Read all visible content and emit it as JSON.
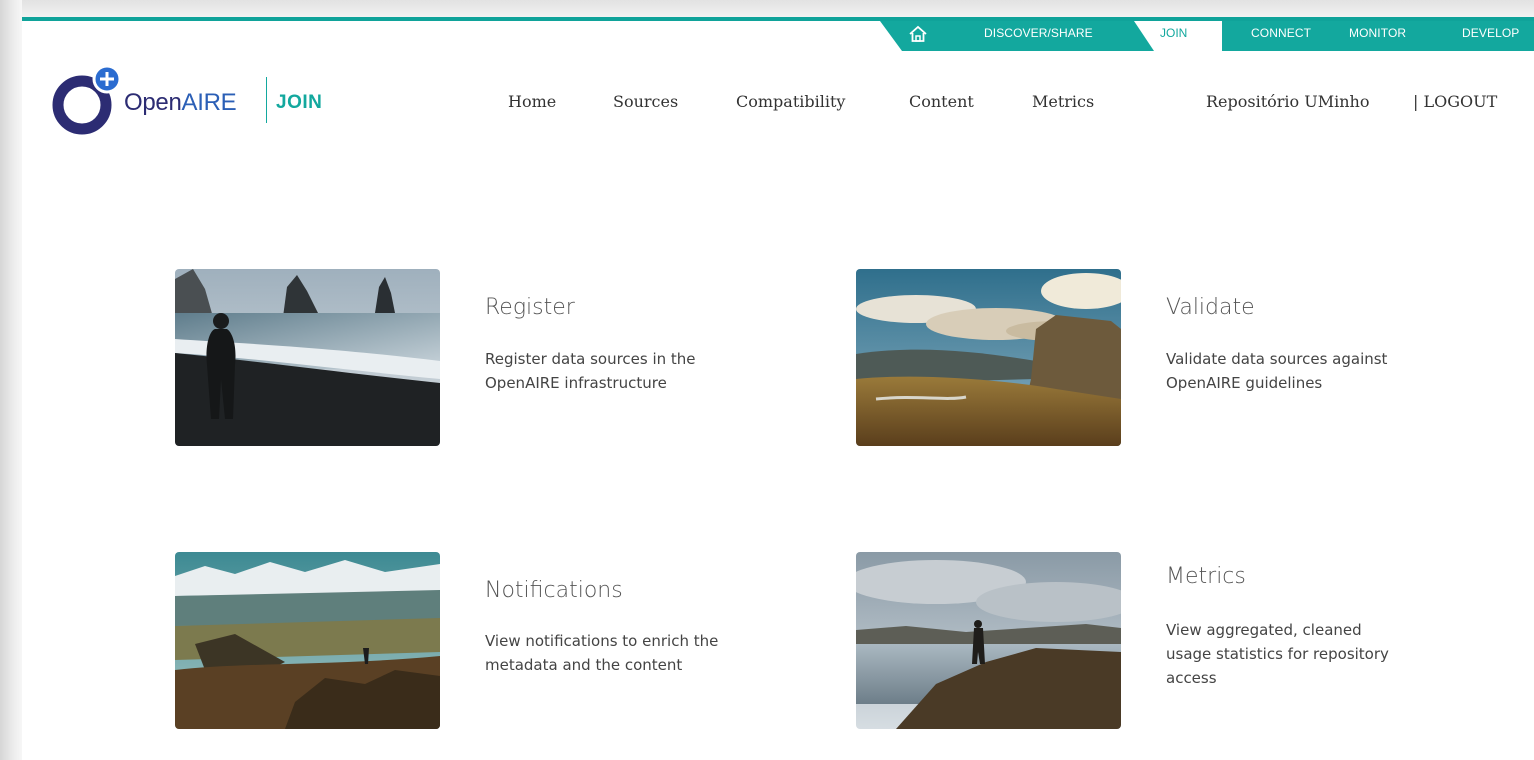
{
  "portal_bar": {
    "items": [
      "DISCOVER/SHARE",
      "JOIN",
      "CONNECT",
      "MONITOR",
      "DEVELOP"
    ],
    "active": "JOIN",
    "home_icon": "home-icon"
  },
  "logo": {
    "open": "Open",
    "aire": "AIRE",
    "join": "JOIN"
  },
  "nav": {
    "items": [
      "Home",
      "Sources",
      "Compatibility",
      "Content",
      "Metrics"
    ],
    "user": "Repositório UMinho",
    "logout": "| LOGOUT"
  },
  "cards": [
    {
      "title": "Register",
      "desc": [
        "Register data sources in the",
        "OpenAIRE infrastructure"
      ]
    },
    {
      "title": "Validate",
      "desc": [
        "Validate data sources against",
        "OpenAIRE guidelines"
      ]
    },
    {
      "title": "Notifications",
      "desc": [
        "View notifications to enrich the",
        "metadata and the content"
      ]
    },
    {
      "title": "Metrics",
      "desc": [
        "View aggregated, cleaned",
        "usage statistics for repository",
        "access"
      ]
    }
  ],
  "colors": {
    "teal": "#13a89e",
    "navy": "#2c2c73",
    "blue": "#2b5fb6"
  }
}
